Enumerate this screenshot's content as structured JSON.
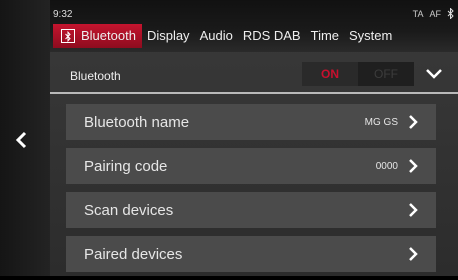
{
  "status": {
    "time": "9:32",
    "ta": "TA",
    "af": "AF",
    "bluetooth_icon": "bluetooth-icon"
  },
  "tabs": [
    {
      "label": "Bluetooth",
      "active": true,
      "icon": "bluetooth-icon"
    },
    {
      "label": "Display"
    },
    {
      "label": "Audio"
    },
    {
      "label": "RDS DAB"
    },
    {
      "label": "Time"
    },
    {
      "label": "System"
    }
  ],
  "header": {
    "label": "Bluetooth",
    "on_label": "ON",
    "off_label": "OFF",
    "state": "ON"
  },
  "rows": [
    {
      "label": "Bluetooth name",
      "value": "MG GS"
    },
    {
      "label": "Pairing code",
      "value": "0000"
    },
    {
      "label": "Scan devices",
      "value": ""
    },
    {
      "label": "Paired devices",
      "value": ""
    }
  ],
  "colors": {
    "accent": "#c8102e",
    "row_bg": "#4b4b4b",
    "panel_bg": "#333333"
  }
}
